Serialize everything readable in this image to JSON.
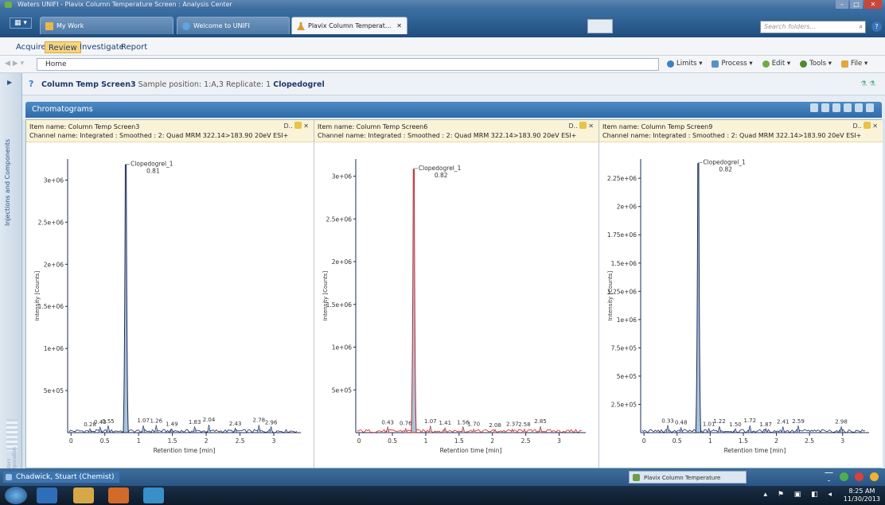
{
  "window": {
    "title": "Waters UNIFI - Plavix Column Temperature Screen : Analysis Center",
    "controls": [
      "–",
      "□",
      "✕"
    ]
  },
  "tabs": [
    {
      "label": "My Work",
      "active": false
    },
    {
      "label": "Welcome to UNIFI",
      "active": false
    },
    {
      "label": "Plavix Column Temperat...",
      "active": true,
      "close": "✕"
    }
  ],
  "search": {
    "placeholder": "Search folders..."
  },
  "menu": [
    {
      "label": "Acquire",
      "active": false
    },
    {
      "label": "Review",
      "active": true
    },
    {
      "label": "Investigate",
      "active": false
    },
    {
      "label": "Report",
      "active": false
    }
  ],
  "nav": {
    "home": "Home"
  },
  "toolbar": {
    "limits": "Limits ▾",
    "process": "Process ▾",
    "edit": "Edit ▾",
    "tools": "Tools ▾",
    "file": "File ▾"
  },
  "sidebar": {
    "label": "Injections and Components",
    "footer": "Waters Corporation"
  },
  "info": {
    "item": "Column Temp Screen3",
    "sample": "Sample position: 1:A,3",
    "replicate": "Replicate: 1",
    "component": "Clopedogrel"
  },
  "section": {
    "title": "Chromatograms"
  },
  "panel_ctl": "D..",
  "panels": [
    {
      "item": "Item name: Column Temp Screen3",
      "channel": "Channel name: Integrated : Smoothed : 2: Quad MRM 322.14>183.90 20eV ESI+"
    },
    {
      "item": "Item name: Column Temp Screen6",
      "channel": "Channel name: Integrated : Smoothed : 2: Quad MRM 322.14>183.90 20eV ESI+"
    },
    {
      "item": "Item name: Column Temp Screen9",
      "channel": "Channel name: Integrated : Smoothed : 2: Quad MRM 322.14>183.90 20eV ESI+"
    }
  ],
  "chart_data": [
    {
      "type": "line",
      "xlabel": "Retention time [min]",
      "ylabel": "Intensity [Counts]",
      "xlim": [
        -0.05,
        3.4
      ],
      "ylim": [
        0,
        3250000
      ],
      "x_ticks": [
        "0",
        "0.5",
        "1",
        "1.5",
        "2",
        "2.5",
        "3"
      ],
      "x_tick_values": [
        0,
        0.5,
        1,
        1.5,
        2,
        2.5,
        3
      ],
      "y_ticks": [
        "5e+05",
        "1e+06",
        "1.5e+06",
        "2e+06",
        "2.5e+06",
        "3e+06"
      ],
      "y_tick_values": [
        500000,
        1000000,
        1500000,
        2000000,
        2500000,
        3000000
      ],
      "color": "#1f2a5c",
      "peak": {
        "name": "Clopedogrel_1",
        "rt": "0.81",
        "x": 0.81,
        "height": 3180000
      },
      "minor_peaks": [
        {
          "label": "0.28",
          "x": 0.28
        },
        {
          "label": "0.43",
          "x": 0.43
        },
        {
          "label": "0.55",
          "x": 0.55
        },
        {
          "label": "1.07",
          "x": 1.07
        },
        {
          "label": "1.26",
          "x": 1.26
        },
        {
          "label": "1.49",
          "x": 1.49
        },
        {
          "label": "1.83",
          "x": 1.83
        },
        {
          "label": "2.04",
          "x": 2.04
        },
        {
          "label": "2.43",
          "x": 2.43
        },
        {
          "label": "2.78",
          "x": 2.78
        },
        {
          "label": "2.96",
          "x": 2.96
        }
      ]
    },
    {
      "type": "line",
      "xlabel": "Retention time [min]",
      "ylabel": "Intensity [Counts]",
      "xlim": [
        -0.05,
        3.4
      ],
      "ylim": [
        0,
        3200000
      ],
      "x_ticks": [
        "0",
        "0.5",
        "1",
        "1.5",
        "2",
        "2.5",
        "3"
      ],
      "x_tick_values": [
        0,
        0.5,
        1,
        1.5,
        2,
        2.5,
        3
      ],
      "y_ticks": [
        "5e+05",
        "1e+06",
        "1.5e+06",
        "2e+06",
        "2.5e+06",
        "3e+06"
      ],
      "y_tick_values": [
        500000,
        1000000,
        1500000,
        2000000,
        2500000,
        3000000
      ],
      "color": "#c0282e",
      "peak": {
        "name": "Clopedogrel_1",
        "rt": "0.82",
        "x": 0.82,
        "height": 3080000
      },
      "minor_peaks": [
        {
          "label": "0.43",
          "x": 0.43
        },
        {
          "label": "0.76",
          "x": 0.7
        },
        {
          "label": "1.07",
          "x": 1.07
        },
        {
          "label": "1.41",
          "x": 1.29
        },
        {
          "label": "1.56",
          "x": 1.56
        },
        {
          "label": "1.70",
          "x": 1.72
        },
        {
          "label": "2.08",
          "x": 2.04
        },
        {
          "label": "2.37",
          "x": 2.3
        },
        {
          "label": "2.58",
          "x": 2.48
        },
        {
          "label": "2.85",
          "x": 2.72
        }
      ]
    },
    {
      "type": "line",
      "xlabel": "Retention time [min]",
      "ylabel": "Intensity [Counts]",
      "xlim": [
        -0.05,
        3.4
      ],
      "ylim": [
        0,
        2420000
      ],
      "x_ticks": [
        "0",
        "0.5",
        "1",
        "1.5",
        "2",
        "2.5",
        "3"
      ],
      "x_tick_values": [
        0,
        0.5,
        1,
        1.5,
        2,
        2.5,
        3
      ],
      "y_ticks": [
        "2.5e+05",
        "5e+05",
        "7.5e+05",
        "1e+06",
        "1.25e+06",
        "1.5e+06",
        "1.75e+06",
        "2e+06",
        "2.25e+06"
      ],
      "y_tick_values": [
        250000,
        500000,
        750000,
        1000000,
        1250000,
        1500000,
        1750000,
        2000000,
        2250000
      ],
      "color": "#1f2a5c",
      "peak": {
        "name": "Clopedogrel_1",
        "rt": "0.82",
        "x": 0.82,
        "height": 2380000
      },
      "minor_peaks": [
        {
          "label": "0.33",
          "x": 0.36
        },
        {
          "label": "0.48",
          "x": 0.56
        },
        {
          "label": "1.01",
          "x": 0.98
        },
        {
          "label": "1.22",
          "x": 1.14
        },
        {
          "label": "1.50",
          "x": 1.38
        },
        {
          "label": "1.72",
          "x": 1.6
        },
        {
          "label": "1.87",
          "x": 1.84
        },
        {
          "label": "2.41",
          "x": 2.1
        },
        {
          "label": "2.59",
          "x": 2.33
        },
        {
          "label": "2.98",
          "x": 2.98
        }
      ]
    }
  ],
  "status": {
    "user": "Chadwick, Stuart (Chemist)",
    "task": "Plavix Column Temperature Screen..."
  },
  "clock": {
    "time": "8:25 AM",
    "date": "11/30/2013"
  }
}
